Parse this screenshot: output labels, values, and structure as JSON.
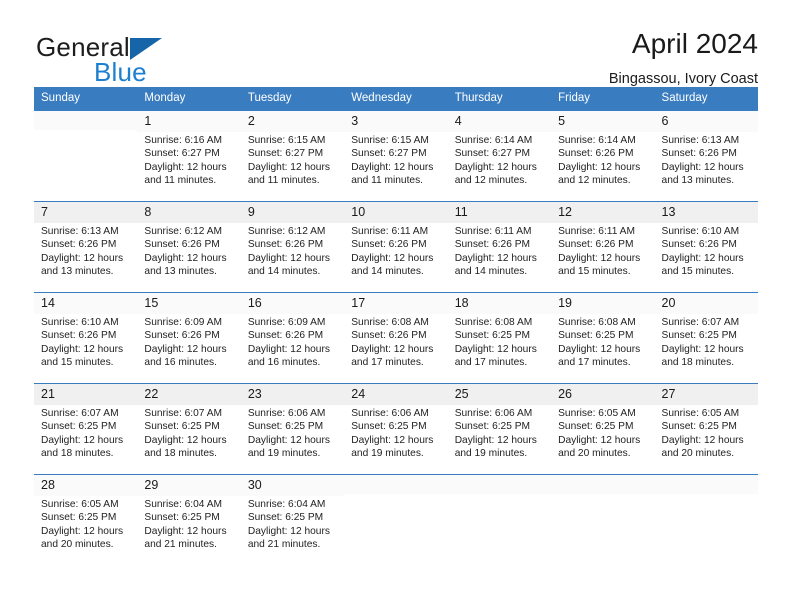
{
  "brand": {
    "word1": "General",
    "word2": "Blue",
    "triangle_color": "#1565a8",
    "blue_color": "#1c7fd0"
  },
  "header": {
    "title": "April 2024",
    "location": "Bingassou, Ivory Coast"
  },
  "calendar": {
    "header_bg": "#3a7cc0",
    "weekdays": [
      "Sunday",
      "Monday",
      "Tuesday",
      "Wednesday",
      "Thursday",
      "Friday",
      "Saturday"
    ],
    "weeks": [
      [
        {
          "day": ""
        },
        {
          "day": "1",
          "sunrise": "Sunrise: 6:16 AM",
          "sunset": "Sunset: 6:27 PM",
          "daylight1": "Daylight: 12 hours",
          "daylight2": "and 11 minutes."
        },
        {
          "day": "2",
          "sunrise": "Sunrise: 6:15 AM",
          "sunset": "Sunset: 6:27 PM",
          "daylight1": "Daylight: 12 hours",
          "daylight2": "and 11 minutes."
        },
        {
          "day": "3",
          "sunrise": "Sunrise: 6:15 AM",
          "sunset": "Sunset: 6:27 PM",
          "daylight1": "Daylight: 12 hours",
          "daylight2": "and 11 minutes."
        },
        {
          "day": "4",
          "sunrise": "Sunrise: 6:14 AM",
          "sunset": "Sunset: 6:27 PM",
          "daylight1": "Daylight: 12 hours",
          "daylight2": "and 12 minutes."
        },
        {
          "day": "5",
          "sunrise": "Sunrise: 6:14 AM",
          "sunset": "Sunset: 6:26 PM",
          "daylight1": "Daylight: 12 hours",
          "daylight2": "and 12 minutes."
        },
        {
          "day": "6",
          "sunrise": "Sunrise: 6:13 AM",
          "sunset": "Sunset: 6:26 PM",
          "daylight1": "Daylight: 12 hours",
          "daylight2": "and 13 minutes."
        }
      ],
      [
        {
          "day": "7",
          "sunrise": "Sunrise: 6:13 AM",
          "sunset": "Sunset: 6:26 PM",
          "daylight1": "Daylight: 12 hours",
          "daylight2": "and 13 minutes."
        },
        {
          "day": "8",
          "sunrise": "Sunrise: 6:12 AM",
          "sunset": "Sunset: 6:26 PM",
          "daylight1": "Daylight: 12 hours",
          "daylight2": "and 13 minutes."
        },
        {
          "day": "9",
          "sunrise": "Sunrise: 6:12 AM",
          "sunset": "Sunset: 6:26 PM",
          "daylight1": "Daylight: 12 hours",
          "daylight2": "and 14 minutes."
        },
        {
          "day": "10",
          "sunrise": "Sunrise: 6:11 AM",
          "sunset": "Sunset: 6:26 PM",
          "daylight1": "Daylight: 12 hours",
          "daylight2": "and 14 minutes."
        },
        {
          "day": "11",
          "sunrise": "Sunrise: 6:11 AM",
          "sunset": "Sunset: 6:26 PM",
          "daylight1": "Daylight: 12 hours",
          "daylight2": "and 14 minutes."
        },
        {
          "day": "12",
          "sunrise": "Sunrise: 6:11 AM",
          "sunset": "Sunset: 6:26 PM",
          "daylight1": "Daylight: 12 hours",
          "daylight2": "and 15 minutes."
        },
        {
          "day": "13",
          "sunrise": "Sunrise: 6:10 AM",
          "sunset": "Sunset: 6:26 PM",
          "daylight1": "Daylight: 12 hours",
          "daylight2": "and 15 minutes."
        }
      ],
      [
        {
          "day": "14",
          "sunrise": "Sunrise: 6:10 AM",
          "sunset": "Sunset: 6:26 PM",
          "daylight1": "Daylight: 12 hours",
          "daylight2": "and 15 minutes."
        },
        {
          "day": "15",
          "sunrise": "Sunrise: 6:09 AM",
          "sunset": "Sunset: 6:26 PM",
          "daylight1": "Daylight: 12 hours",
          "daylight2": "and 16 minutes."
        },
        {
          "day": "16",
          "sunrise": "Sunrise: 6:09 AM",
          "sunset": "Sunset: 6:26 PM",
          "daylight1": "Daylight: 12 hours",
          "daylight2": "and 16 minutes."
        },
        {
          "day": "17",
          "sunrise": "Sunrise: 6:08 AM",
          "sunset": "Sunset: 6:26 PM",
          "daylight1": "Daylight: 12 hours",
          "daylight2": "and 17 minutes."
        },
        {
          "day": "18",
          "sunrise": "Sunrise: 6:08 AM",
          "sunset": "Sunset: 6:25 PM",
          "daylight1": "Daylight: 12 hours",
          "daylight2": "and 17 minutes."
        },
        {
          "day": "19",
          "sunrise": "Sunrise: 6:08 AM",
          "sunset": "Sunset: 6:25 PM",
          "daylight1": "Daylight: 12 hours",
          "daylight2": "and 17 minutes."
        },
        {
          "day": "20",
          "sunrise": "Sunrise: 6:07 AM",
          "sunset": "Sunset: 6:25 PM",
          "daylight1": "Daylight: 12 hours",
          "daylight2": "and 18 minutes."
        }
      ],
      [
        {
          "day": "21",
          "sunrise": "Sunrise: 6:07 AM",
          "sunset": "Sunset: 6:25 PM",
          "daylight1": "Daylight: 12 hours",
          "daylight2": "and 18 minutes."
        },
        {
          "day": "22",
          "sunrise": "Sunrise: 6:07 AM",
          "sunset": "Sunset: 6:25 PM",
          "daylight1": "Daylight: 12 hours",
          "daylight2": "and 18 minutes."
        },
        {
          "day": "23",
          "sunrise": "Sunrise: 6:06 AM",
          "sunset": "Sunset: 6:25 PM",
          "daylight1": "Daylight: 12 hours",
          "daylight2": "and 19 minutes."
        },
        {
          "day": "24",
          "sunrise": "Sunrise: 6:06 AM",
          "sunset": "Sunset: 6:25 PM",
          "daylight1": "Daylight: 12 hours",
          "daylight2": "and 19 minutes."
        },
        {
          "day": "25",
          "sunrise": "Sunrise: 6:06 AM",
          "sunset": "Sunset: 6:25 PM",
          "daylight1": "Daylight: 12 hours",
          "daylight2": "and 19 minutes."
        },
        {
          "day": "26",
          "sunrise": "Sunrise: 6:05 AM",
          "sunset": "Sunset: 6:25 PM",
          "daylight1": "Daylight: 12 hours",
          "daylight2": "and 20 minutes."
        },
        {
          "day": "27",
          "sunrise": "Sunrise: 6:05 AM",
          "sunset": "Sunset: 6:25 PM",
          "daylight1": "Daylight: 12 hours",
          "daylight2": "and 20 minutes."
        }
      ],
      [
        {
          "day": "28",
          "sunrise": "Sunrise: 6:05 AM",
          "sunset": "Sunset: 6:25 PM",
          "daylight1": "Daylight: 12 hours",
          "daylight2": "and 20 minutes."
        },
        {
          "day": "29",
          "sunrise": "Sunrise: 6:04 AM",
          "sunset": "Sunset: 6:25 PM",
          "daylight1": "Daylight: 12 hours",
          "daylight2": "and 21 minutes."
        },
        {
          "day": "30",
          "sunrise": "Sunrise: 6:04 AM",
          "sunset": "Sunset: 6:25 PM",
          "daylight1": "Daylight: 12 hours",
          "daylight2": "and 21 minutes."
        },
        {
          "day": ""
        },
        {
          "day": ""
        },
        {
          "day": ""
        },
        {
          "day": ""
        }
      ]
    ]
  }
}
